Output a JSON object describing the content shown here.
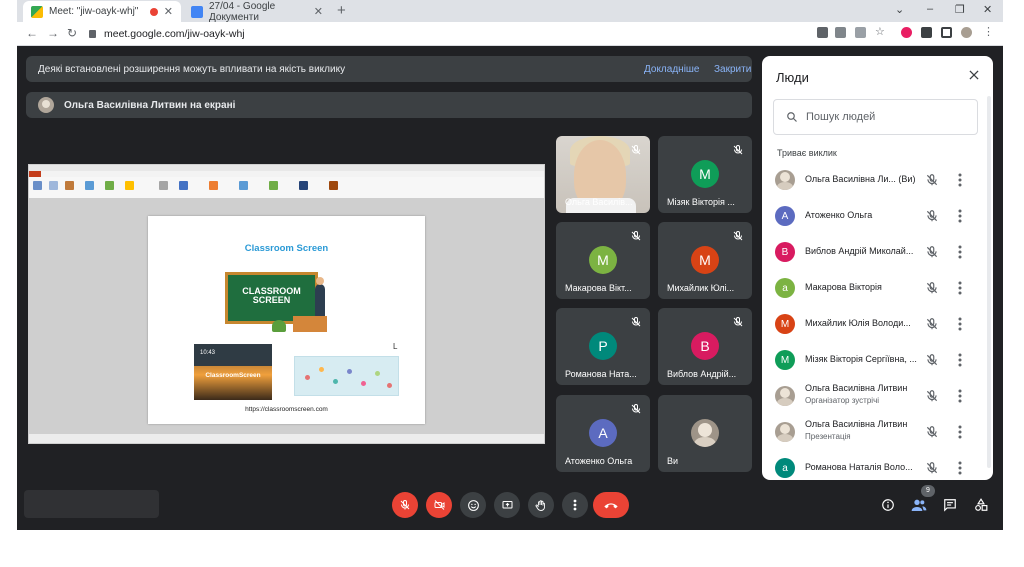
{
  "browser": {
    "tabs": [
      {
        "title": "Meet: \"jiw-oayk-whj\"",
        "close": "✕"
      },
      {
        "title": "27/04 - Google Документи",
        "close": "✕"
      }
    ],
    "new_tab": "+",
    "url": "meet.google.com/jiw-oayk-whj",
    "window_controls": [
      "⌄",
      "–",
      "❐",
      "✕"
    ]
  },
  "banners": {
    "extensions": {
      "text": "Деякі встановлені розширення можуть впливати на якість виклику",
      "learn_more": "Докладніше",
      "close": "Закрити"
    },
    "presenting": {
      "text": "Ольга Василівна Литвин на екрані"
    }
  },
  "slide": {
    "title": "Classroom Screen",
    "board_text_1": "CLASSROOM",
    "board_text_2": "SCREEN",
    "thumb_label": "ClassroomScreen",
    "thumb_time": "10:43",
    "url": "https://classroomscreen.com",
    "cursor": "L"
  },
  "tiles": [
    {
      "name": "Ольга Василів...",
      "type": "video"
    },
    {
      "name": "Мізяк Вікторія ...",
      "initial": "М",
      "color": "#0f9d58"
    },
    {
      "name": "Макарова Вікт...",
      "initial": "М",
      "color": "#7cb342"
    },
    {
      "name": "Михайлик Юлі...",
      "initial": "М",
      "color": "#d84315"
    },
    {
      "name": "Романова Ната...",
      "initial": "Р",
      "color": "#00897b"
    },
    {
      "name": "Виблов Андрій...",
      "initial": "В",
      "color": "#d81b60"
    },
    {
      "name": "Атоженко Ольга",
      "initial": "А",
      "color": "#5c6bc0"
    },
    {
      "name": "Ви",
      "type": "photo"
    }
  ],
  "people": {
    "title": "Люди",
    "search_placeholder": "Пошук людей",
    "section": "Триває виклик",
    "list": [
      {
        "name": "Ольга Василівна Ли... (Ви)",
        "type": "photo"
      },
      {
        "name": "Атоженко Ольга",
        "initial": "А",
        "color": "#5c6bc0"
      },
      {
        "name": "Виблов Андрій Миколай...",
        "initial": "В",
        "color": "#d81b60"
      },
      {
        "name": "Макарова Вікторія",
        "initial": "a",
        "color": "#7cb342"
      },
      {
        "name": "Михайлик Юлія Володи...",
        "initial": "М",
        "color": "#d84315"
      },
      {
        "name": "Мізяк Вікторія Сергіївна, ...",
        "initial": "М",
        "color": "#0f9d58"
      },
      {
        "name": "Ольга Василівна Литвин",
        "sub": "Організатор зустрічі",
        "type": "photo"
      },
      {
        "name": "Ольга Василівна Литвин",
        "sub": "Презентація",
        "type": "photo"
      },
      {
        "name": "Романова Наталія Воло...",
        "initial": "a",
        "color": "#00897b"
      }
    ]
  },
  "controls": {
    "participants_count": "9"
  }
}
